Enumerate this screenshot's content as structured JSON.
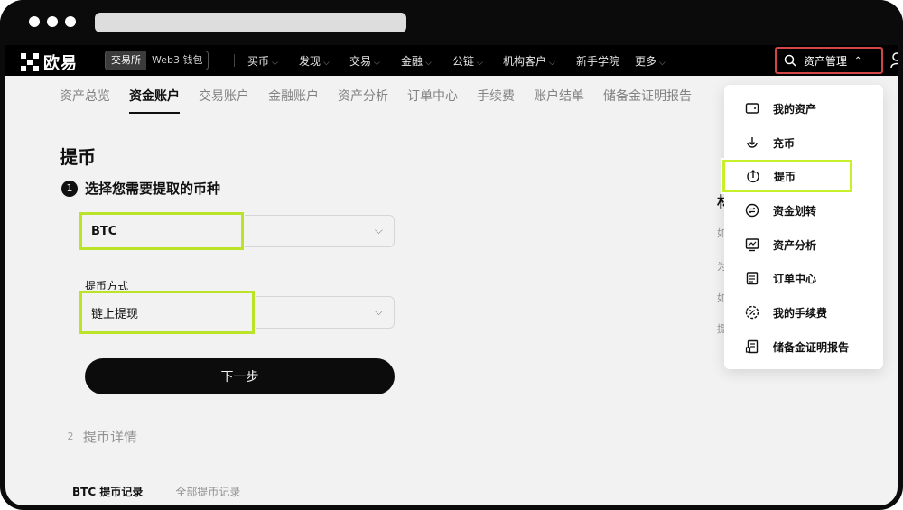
{
  "brand": {
    "logo_text": "欧易"
  },
  "nav": {
    "segment": [
      "交易所",
      "Web3 钱包"
    ],
    "items": [
      {
        "label": "买币",
        "chevron": true
      },
      {
        "label": "发现",
        "chevron": true
      },
      {
        "label": "交易",
        "chevron": true
      },
      {
        "label": "金融",
        "chevron": true
      },
      {
        "label": "公链",
        "chevron": true
      },
      {
        "label": "机构客户",
        "chevron": true
      },
      {
        "label": "新手学院",
        "chevron": false
      },
      {
        "label": "更多",
        "chevron": true
      }
    ],
    "asset_button": "资产管理"
  },
  "subtabs": [
    "资产总览",
    "资金账户",
    "交易账户",
    "金融账户",
    "资产分析",
    "订单中心",
    "手续费",
    "账户结单",
    "储备金证明报告"
  ],
  "page": {
    "title": "提币",
    "step1": {
      "num": "1",
      "label": "选择您需要提取的币种"
    },
    "coin_value": "BTC",
    "method_label": "提币方式",
    "method_value": "链上提现",
    "next_button": "下一步",
    "step2": {
      "num": "2",
      "label": "提币详情"
    },
    "record_tabs": [
      "BTC 提币记录",
      "全部提币记录"
    ]
  },
  "side_peek": [
    "林",
    "如",
    "为",
    "如",
    "提"
  ],
  "dropdown": [
    {
      "label": "我的资产",
      "icon": "wallet-icon"
    },
    {
      "label": "充币",
      "icon": "deposit-icon"
    },
    {
      "label": "提币",
      "icon": "withdraw-icon",
      "selected": true
    },
    {
      "label": "资金划转",
      "icon": "transfer-icon"
    },
    {
      "label": "资产分析",
      "icon": "analysis-icon"
    },
    {
      "label": "订单中心",
      "icon": "order-icon"
    },
    {
      "label": "我的手续费",
      "icon": "fee-icon"
    },
    {
      "label": "储备金证明报告",
      "icon": "reserve-report-icon"
    }
  ],
  "colors": {
    "highlight": "#c6f02a",
    "asset_border": "#d64545",
    "nav_bg": "#000000"
  }
}
